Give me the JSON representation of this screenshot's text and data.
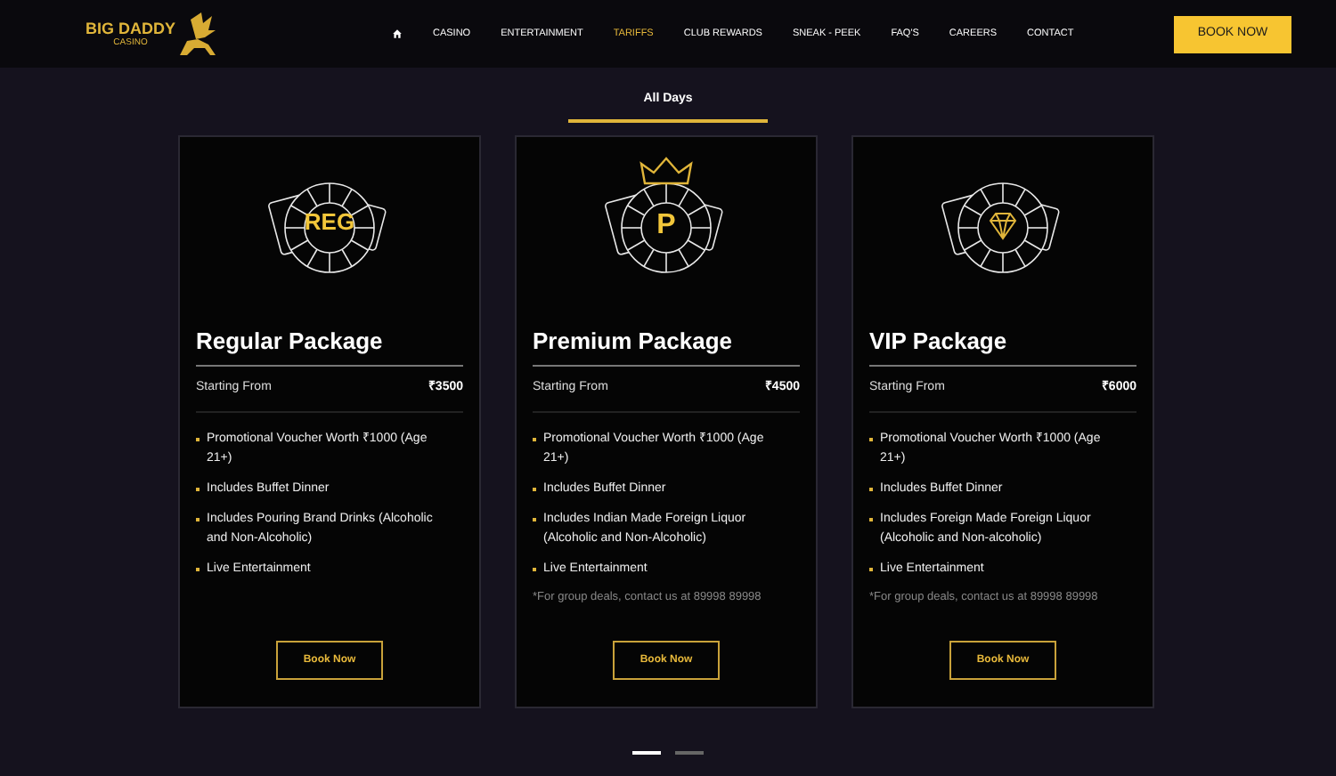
{
  "header": {
    "logo": {
      "title": "BIG DADDY",
      "subtitle": "CASINO"
    },
    "nav": [
      {
        "kind": "home",
        "selected": false
      },
      {
        "kind": "text",
        "label": "CASINO",
        "selected": false
      },
      {
        "kind": "text",
        "label": "ENTERTAINMENT",
        "selected": false
      },
      {
        "kind": "text",
        "label": "TARIFFS",
        "selected": true
      },
      {
        "kind": "text",
        "label": "CLUB REWARDS",
        "selected": false
      },
      {
        "kind": "text",
        "label": "SNEAK - PEEK",
        "selected": false
      },
      {
        "kind": "text",
        "label": "FAQ'S",
        "selected": false
      },
      {
        "kind": "text",
        "label": "CAREERS",
        "selected": false
      },
      {
        "kind": "text",
        "label": "CONTACT",
        "selected": false
      }
    ],
    "cta": "BOOK NOW"
  },
  "tabs": [
    {
      "label": "All Days",
      "selected": true
    }
  ],
  "packages": [
    {
      "emblem": {
        "kind": "letters",
        "text": "REG",
        "crown": false
      },
      "title": "Regular Package",
      "price_label": "Starting From",
      "price": "₹3500",
      "features": [
        "Promotional Voucher Worth ₹1000 (Age 21+)",
        "Includes Buffet Dinner",
        "Includes Pouring Brand Drinks (Alcoholic and Non-Alcoholic)",
        "Live Entertainment"
      ],
      "button": "Book Now"
    },
    {
      "emblem": {
        "kind": "letters",
        "text": "P",
        "crown": true
      },
      "title": "Premium Package",
      "price_label": "Starting From",
      "price": "₹4500",
      "features": [
        "Promotional Voucher Worth ₹1000 (Age 21+)",
        "Includes Buffet Dinner",
        "Includes Indian Made Foreign Liquor (Alcoholic and Non-Alcoholic)",
        "Live Entertainment"
      ],
      "note": "*For group deals, contact us at 89998 89998",
      "button": "Book Now"
    },
    {
      "emblem": {
        "kind": "diamond",
        "crown": false
      },
      "title": "VIP Package",
      "price_label": "Starting From",
      "price": "₹6000",
      "features": [
        "Promotional Voucher Worth ₹1000 (Age 21+)",
        "Includes Buffet Dinner",
        "Includes Foreign Made Foreign Liquor (Alcoholic and Non-alcoholic)",
        "Live Entertainment"
      ],
      "note": "*For group deals, contact us at 89998 89998",
      "button": "Book Now"
    }
  ],
  "pager": [
    {
      "selected": true
    },
    {
      "selected": false
    }
  ]
}
